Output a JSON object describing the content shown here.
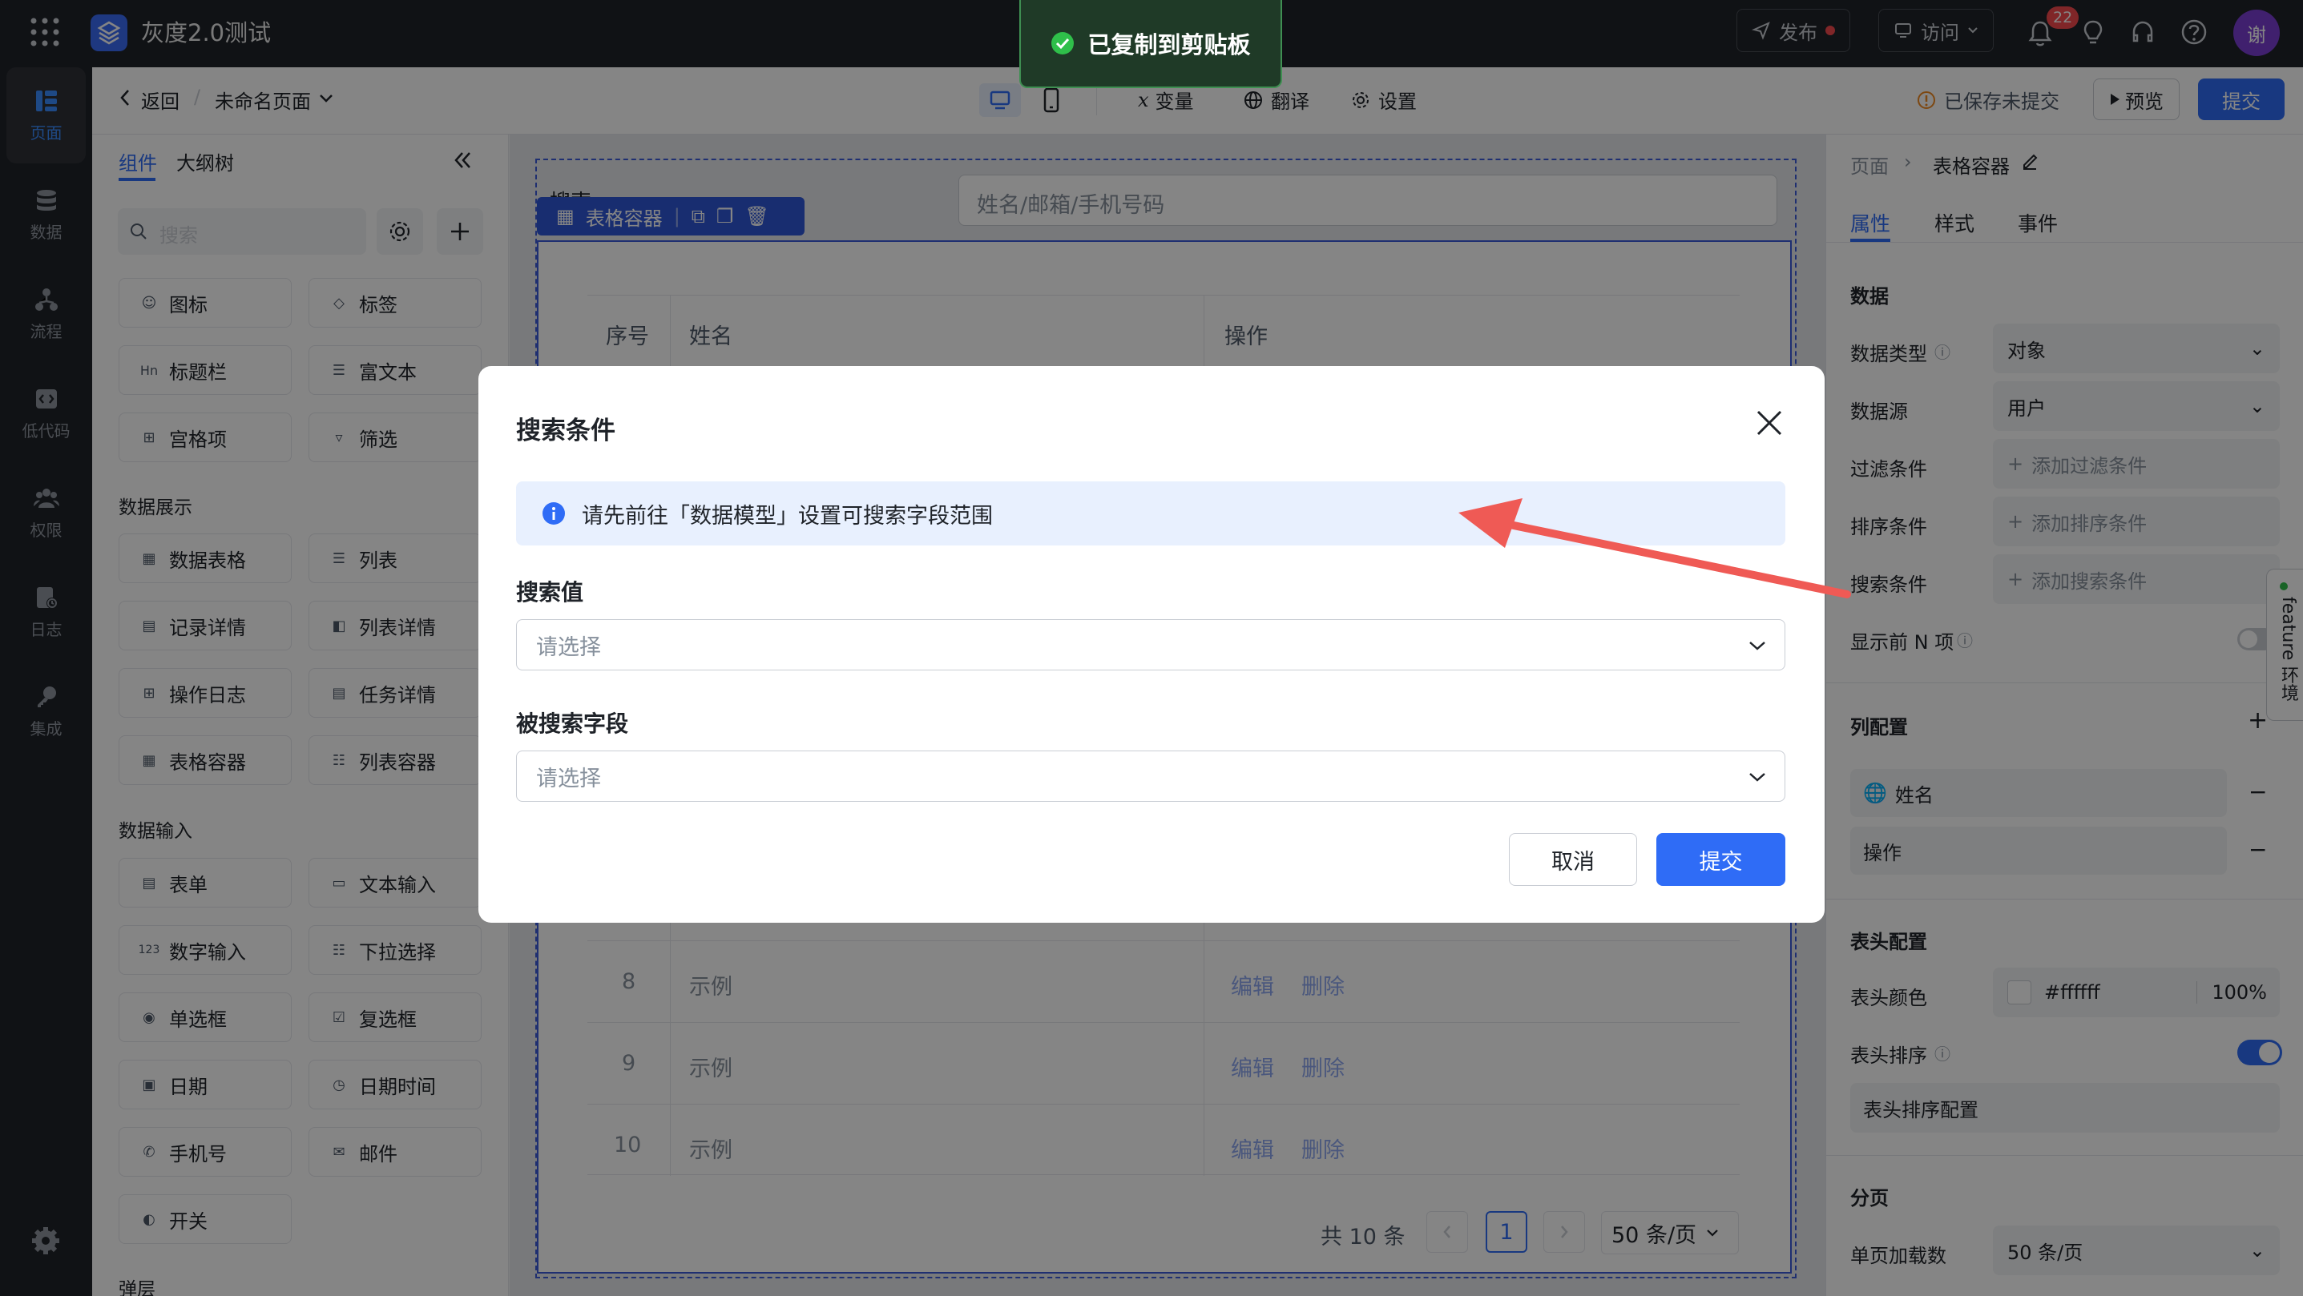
{
  "app": {
    "title": "灰度2.0测试",
    "avatar": "谢",
    "notifications": "22"
  },
  "topbar": {
    "publish": "发布",
    "visit": "访问"
  },
  "toast": "已复制到剪贴板",
  "rail": [
    {
      "label": "页面",
      "icon": "page-icon"
    },
    {
      "label": "数据",
      "icon": "database-icon"
    },
    {
      "label": "流程",
      "icon": "flow-icon"
    },
    {
      "label": "低代码",
      "icon": "code-icon"
    },
    {
      "label": "权限",
      "icon": "users-icon"
    },
    {
      "label": "日志",
      "icon": "log-icon"
    },
    {
      "label": "集成",
      "icon": "key-icon"
    }
  ],
  "subbar": {
    "back": "返回",
    "page_name": "未命名页面",
    "variables": "变量",
    "translate": "翻译",
    "settings": "设置",
    "save_status": "已保存未提交",
    "preview": "预览",
    "submit": "提交"
  },
  "left_panel": {
    "tabs": [
      "组件",
      "大纲树"
    ],
    "search_placeholder": "搜索",
    "basic": [
      "图标",
      "标签",
      "标题栏",
      "富文本",
      "宫格项",
      "筛选"
    ],
    "data_display_title": "数据展示",
    "data_display": [
      "数据表格",
      "列表",
      "记录详情",
      "列表详情",
      "操作日志",
      "任务详情",
      "表格容器",
      "列表容器"
    ],
    "data_input_title": "数据输入",
    "data_input": [
      "表单",
      "文本输入",
      "数字输入",
      "下拉选择",
      "单选框",
      "复选框",
      "日期",
      "日期时间",
      "手机号",
      "邮件",
      "开关"
    ],
    "overlay_title": "弹层"
  },
  "canvas": {
    "search_label": "搜索",
    "search_placeholder": "姓名/邮箱/手机号码",
    "toolbar_label": "表格容器",
    "columns": [
      "序号",
      "姓名",
      "操作"
    ],
    "rows": [
      {
        "index": "8",
        "name": "示例",
        "edit": "编辑",
        "delete": "删除"
      },
      {
        "index": "9",
        "name": "示例",
        "edit": "编辑",
        "delete": "删除"
      },
      {
        "index": "10",
        "name": "示例",
        "edit": "编辑",
        "delete": "删除"
      }
    ],
    "pagination": {
      "total": "共 10 条",
      "page": "1",
      "page_size": "50 条/页"
    }
  },
  "right_panel": {
    "breadcrumb_root": "页面",
    "breadcrumb_current": "表格容器",
    "tabs": [
      "属性",
      "样式",
      "事件"
    ],
    "data_section": "数据",
    "data_type_label": "数据类型",
    "data_type_value": "对象",
    "data_source_label": "数据源",
    "data_source_value": "用户",
    "filter_label": "过滤条件",
    "filter_add": "添加过滤条件",
    "sort_label": "排序条件",
    "sort_add": "添加排序条件",
    "search_label": "搜索条件",
    "search_add": "添加搜索条件",
    "top_n_label": "显示前 N 项",
    "column_section": "列配置",
    "columns": [
      "姓名",
      "操作"
    ],
    "header_section": "表头配置",
    "header_color_label": "表头颜色",
    "header_color_value": "#ffffff",
    "header_opacity": "100%",
    "header_sort_label": "表头排序",
    "header_sort_config": "表头排序配置",
    "pagination_section": "分页",
    "page_load_label": "单页加载数",
    "page_load_value": "50 条/页",
    "feature_tab": "feature 环境"
  },
  "modal": {
    "title": "搜索条件",
    "info": "请先前往「数据模型」设置可搜索字段范围",
    "search_value_label": "搜索值",
    "search_value_placeholder": "请选择",
    "searched_field_label": "被搜索字段",
    "searched_field_placeholder": "请选择",
    "cancel": "取消",
    "submit": "提交"
  },
  "colors": {
    "primary": "#2f6cf6",
    "dark_bar": "#1f2329",
    "annotation_arrow": "#ef5a55",
    "toast_bg": "#1f3a27"
  }
}
